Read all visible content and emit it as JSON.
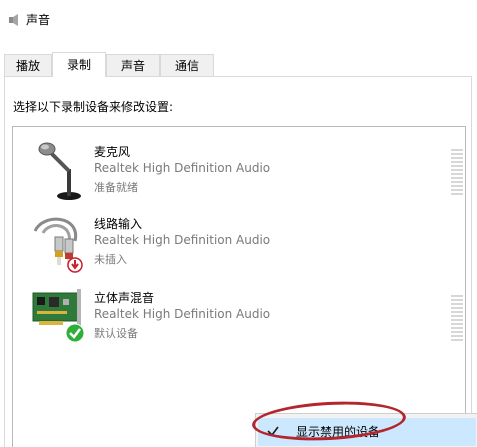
{
  "window": {
    "title": "声音",
    "icon": "speaker-icon"
  },
  "tabs": [
    {
      "label": "播放",
      "active": false
    },
    {
      "label": "录制",
      "active": true
    },
    {
      "label": "声音",
      "active": false
    },
    {
      "label": "通信",
      "active": false
    }
  ],
  "instruction": "选择以下录制设备来修改设置:",
  "devices": [
    {
      "name": "麦克风",
      "driver": "Realtek High Definition Audio",
      "status": "准备就绪",
      "icon": "microphone-icon",
      "badge": ""
    },
    {
      "name": "线路输入",
      "driver": "Realtek High Definition Audio",
      "status": "未插入",
      "icon": "line-in-cable-icon",
      "badge": "unplugged-badge-icon"
    },
    {
      "name": "立体声混音",
      "driver": "Realtek High Definition Audio",
      "status": "默认设备",
      "icon": "sound-card-icon",
      "badge": "default-check-badge-icon"
    }
  ],
  "context_menu": {
    "items": [
      {
        "label": "显示禁用的设备",
        "checked": true
      }
    ]
  },
  "colors": {
    "menu_highlight": "#cce8ff",
    "annotation_oval": "#b3262e",
    "default_badge": "#2fae3a",
    "unplugged_badge": "#c9202a"
  }
}
